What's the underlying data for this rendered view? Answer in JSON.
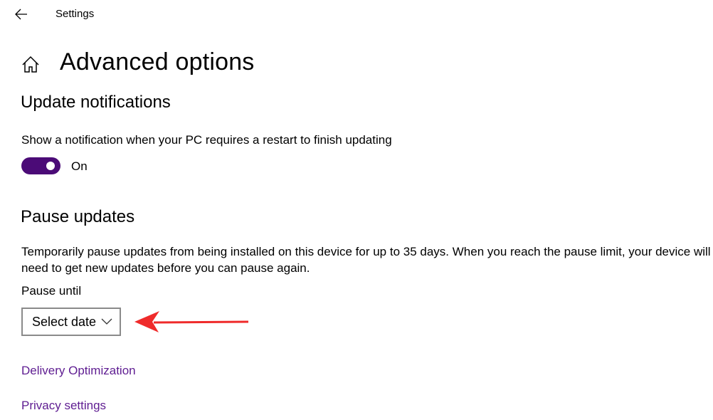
{
  "window": {
    "app_title": "Settings"
  },
  "header": {
    "page_title": "Advanced options"
  },
  "update_notifications": {
    "section_title": "Update notifications",
    "description": "Show a notification when your PC requires a restart to finish updating",
    "toggle_state": "On"
  },
  "pause_updates": {
    "section_title": "Pause updates",
    "description_line1": "Temporarily pause updates from being installed on this device for up to 35 days. When you reach the pause limit, your device will",
    "description_line2": "need to get new updates before you can pause again.",
    "pause_until_label": "Pause until",
    "select_value": "Select date"
  },
  "links": {
    "delivery_optimization": "Delivery Optimization",
    "privacy_settings": "Privacy settings"
  },
  "colors": {
    "toggle_on": "#4b0b77",
    "link": "#5e1c91",
    "annotation_arrow": "#ef2b2b"
  },
  "icons": {
    "back": "arrow-left-icon",
    "home": "home-icon",
    "dropdown": "chevron-down-icon"
  }
}
